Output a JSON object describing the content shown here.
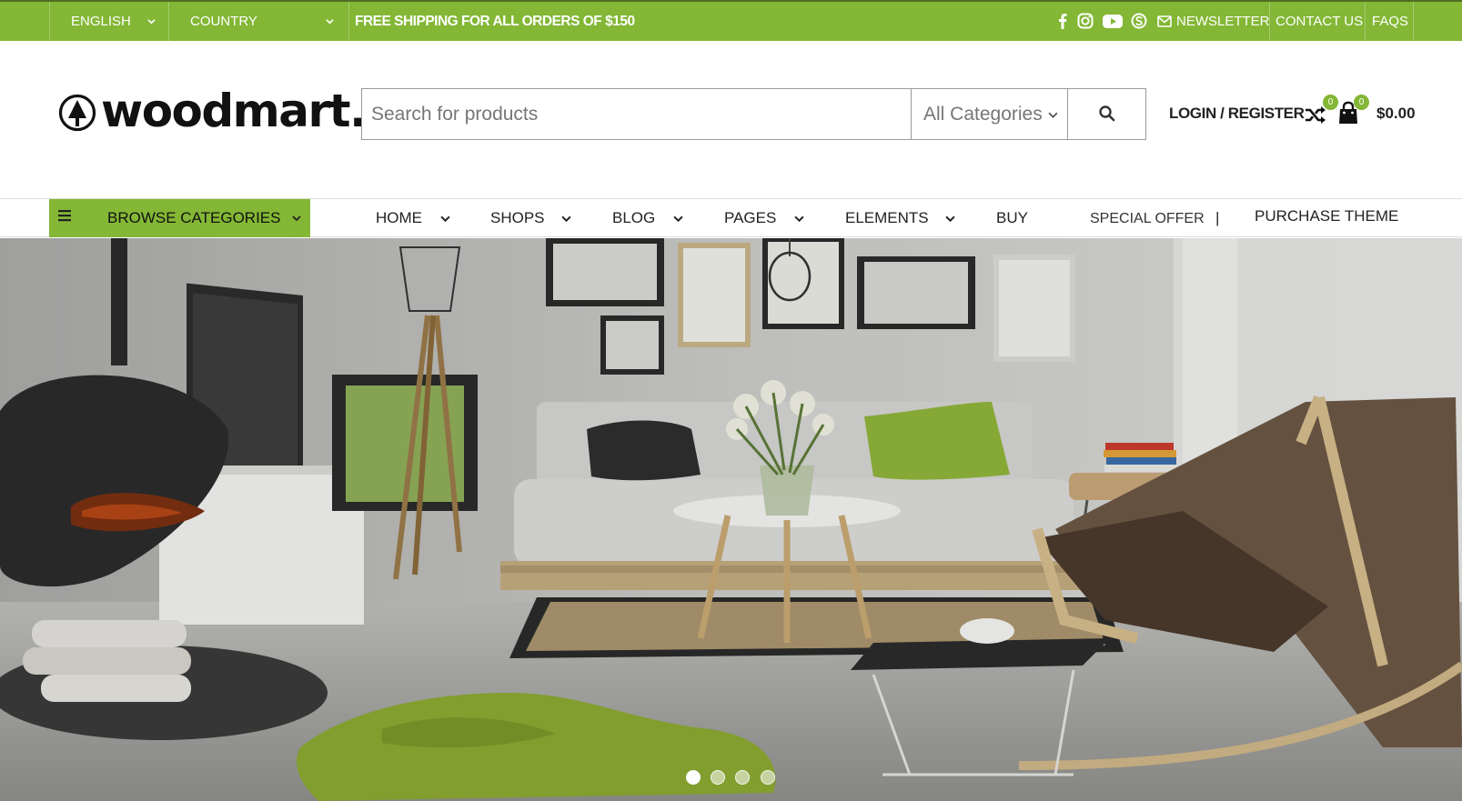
{
  "topbar": {
    "language": "ENGLISH",
    "country": "COUNTRY",
    "promo": "FREE SHIPPING FOR ALL ORDERS OF $150",
    "social_icons": [
      "facebook-icon",
      "instagram-icon",
      "youtube-icon",
      "skype-icon"
    ],
    "newsletter": "NEWSLETTER",
    "contact": "CONTACT US",
    "faqs": "FAQS",
    "bg_color": "#83b735"
  },
  "header": {
    "logo_text": "woodmart.",
    "search": {
      "placeholder": "Search for products",
      "category": "All Categories"
    },
    "login": "LOGIN / REGISTER",
    "compare_count": "0",
    "cart_count": "0",
    "cart_total": "$0.00"
  },
  "nav": {
    "browse": "BROWSE CATEGORIES",
    "items": [
      {
        "label": "HOME"
      },
      {
        "label": "SHOPS"
      },
      {
        "label": "BLOG"
      },
      {
        "label": "PAGES"
      },
      {
        "label": "ELEMENTS"
      },
      {
        "label": "BUY"
      },
      {
        "label": "SPECIAL OFFER"
      },
      {
        "label": "PURCHASE THEME"
      }
    ],
    "separator": "|"
  },
  "hero": {
    "slides": 4,
    "active_slide": 1
  },
  "colors": {
    "accent": "#83b735",
    "text": "#222222"
  }
}
